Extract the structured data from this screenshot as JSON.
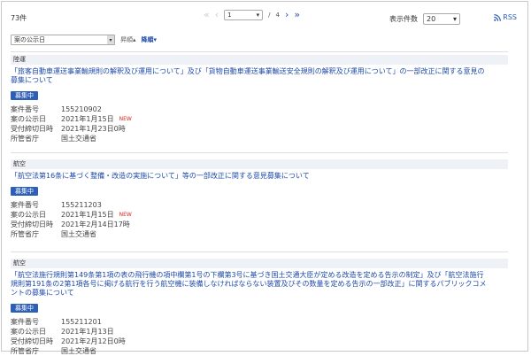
{
  "header": {
    "count": "73件",
    "pager": {
      "first_icon": "«",
      "prev_icon": "‹",
      "current_page": "1",
      "separator": "/",
      "total_pages": "4",
      "next_icon": "›",
      "last_icon": "»"
    },
    "display_label": "表示件数",
    "display_value": "20",
    "rss_label": "RSS"
  },
  "sort": {
    "field": "案の公示日",
    "asc_label": "昇順",
    "desc_label": "降順"
  },
  "items": [
    {
      "category": "陸運",
      "title": "「旅客自動車運送事業輸規則の解釈及び運用について」及び「貨物自動車運送事業輸送安全規則の解釈及び運用について」の一部改正に関する意見の募集について",
      "status": "募集中",
      "meta": [
        {
          "key": "案件番号",
          "value": "155210902",
          "new": ""
        },
        {
          "key": "案の公示日",
          "value": "2021年1月15日",
          "new": "NEW"
        },
        {
          "key": "受付締切日時",
          "value": "2021年1月23日0時",
          "new": ""
        },
        {
          "key": "所管省庁",
          "value": "国土交通省",
          "new": ""
        }
      ]
    },
    {
      "category": "航空",
      "title": "「航空法第16条に基づく整備・改造の実施について」等の一部改正に関する意見募集について",
      "status": "募集中",
      "meta": [
        {
          "key": "案件番号",
          "value": "155211203",
          "new": ""
        },
        {
          "key": "案の公示日",
          "value": "2021年1月15日",
          "new": "NEW"
        },
        {
          "key": "受付締切日時",
          "value": "2021年2月14日17時",
          "new": ""
        },
        {
          "key": "所管省庁",
          "value": "国土交通省",
          "new": ""
        }
      ]
    },
    {
      "category": "航空",
      "title": "「航空法施行規則第149条第1項の表の飛行機の項中欄第1号の下欄第3号に基づき国土交通大臣が定める改造を定める告示の制定」及び「航空法施行規則第191条の2第1項各号に掲げる航行を行う航空機に装備しなければならない装置及びその数量を定める告示の一部改正」に関するパブリックコメントの募集について",
      "status": "募集中",
      "meta": [
        {
          "key": "案件番号",
          "value": "155211201",
          "new": ""
        },
        {
          "key": "案の公示日",
          "value": "2021年1月13日",
          "new": ""
        },
        {
          "key": "受付締切日時",
          "value": "2021年2月12日0時",
          "new": ""
        },
        {
          "key": "所管省庁",
          "value": "国土交通省",
          "new": ""
        }
      ]
    }
  ],
  "colors": {
    "link": "#1d4aa8",
    "badge": "#2e5fb7",
    "new": "#d9251c",
    "category_bg": "#eef1f6"
  }
}
